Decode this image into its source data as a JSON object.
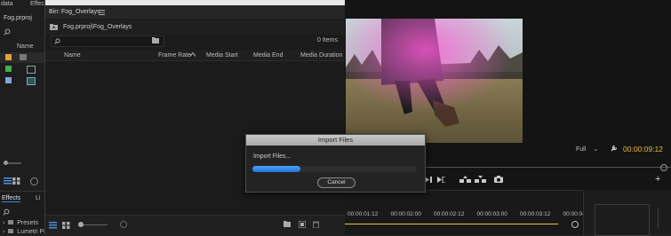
{
  "menu": {
    "left_tab_1": "data",
    "left_tab_2": "Effec"
  },
  "project": {
    "name": "Fog.prproj",
    "name_col": "Name"
  },
  "effects_panel": {
    "tab": "Effects",
    "tab2": "Li",
    "items": [
      "Presets",
      "Lumetri Pr"
    ]
  },
  "bin": {
    "title": "Bin: Fog_Overlays",
    "path": "Fog.prproj\\Fog_Overlays",
    "item_count": "0 Items",
    "columns": [
      "Name",
      "Frame Rate",
      "Media Start",
      "Media End",
      "Media Duration"
    ]
  },
  "program": {
    "zoom": "Full",
    "timecode": "00:00:09:12"
  },
  "timeline": {
    "times": [
      "00:00:01:12",
      "00:00:02:00",
      "00:00:02:12",
      "00:00:03:00",
      "00:00:03:12",
      "00:00:04:"
    ]
  },
  "dialog": {
    "title": "Import Files",
    "status": "Import Files...",
    "progress": 0.29,
    "cancel": "Cancel"
  },
  "colors": {
    "accent_blue": "#2d8ceb",
    "label_orange": "#e6a23c",
    "label_green": "#43b04a",
    "label_blue": "#7fa7d8"
  }
}
